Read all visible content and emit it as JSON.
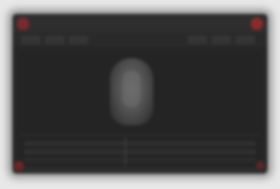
{
  "window": {
    "title": "",
    "colors": {
      "background": "#262626",
      "titlebar": "#2e2e2e",
      "accent_red": "#8a2b2b"
    }
  },
  "titlebar": {
    "left_icon": "close-dot-icon",
    "right_icon": "record-dot-icon"
  },
  "toolbar": {
    "tool_icons": [
      "tool-icon",
      "tool-icon",
      "tool-icon",
      "tool-icon",
      "tool-icon",
      "tool-icon"
    ]
  },
  "viewport": {
    "content": "preview-figure"
  },
  "timeline": {
    "tracks": 3
  }
}
